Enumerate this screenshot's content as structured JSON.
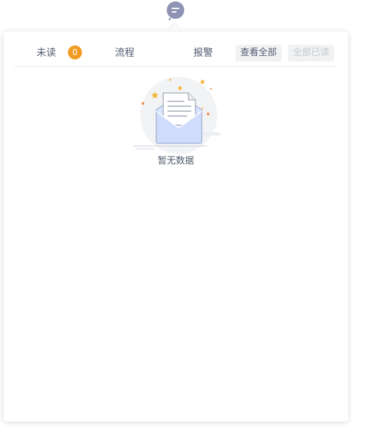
{
  "tabs": [
    {
      "label": "未读",
      "badge": "0"
    },
    {
      "label": "流程"
    },
    {
      "label": "报警"
    }
  ],
  "actions": {
    "view_all": "查看全部",
    "mark_all_read": "全部已读"
  },
  "empty": {
    "text": "暂无数据"
  },
  "colors": {
    "badge": "#f29b23",
    "trigger": "#8e93b3",
    "text": "#515a6e",
    "disabled": "#c5c8ce"
  },
  "icons": [
    "message-icon",
    "empty-mailbox-illustration"
  ]
}
